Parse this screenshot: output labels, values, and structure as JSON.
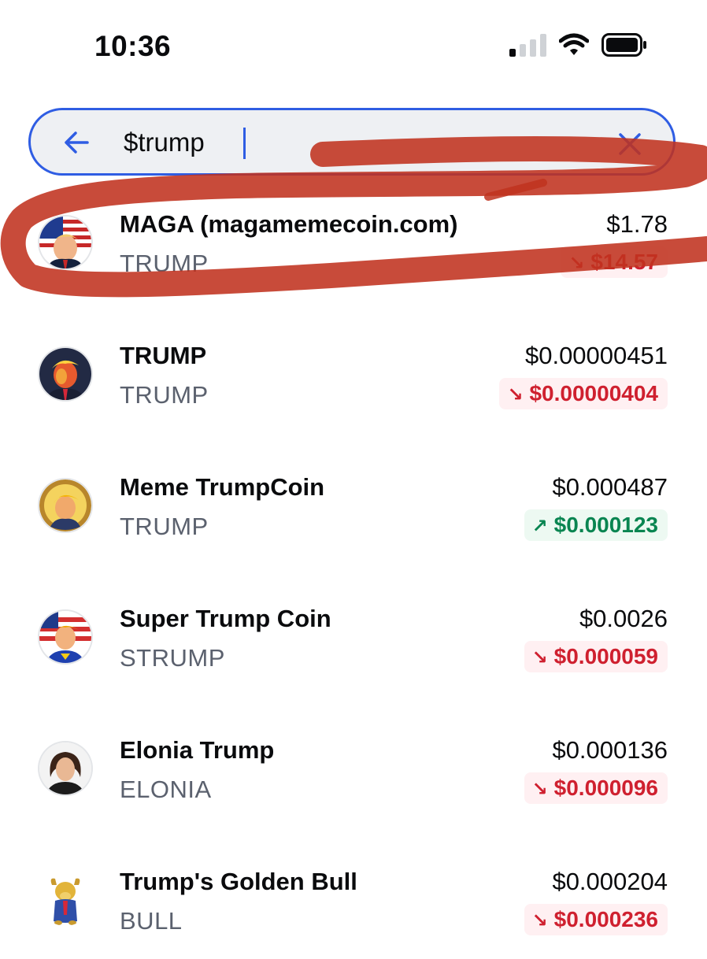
{
  "status_bar": {
    "time": "10:36"
  },
  "search": {
    "value": "$trump"
  },
  "results": [
    {
      "name": "MAGA (magamemecoin.com)",
      "ticker": "TRUMP",
      "price": "$1.78",
      "change": "$14.57",
      "direction": "down",
      "avatar": "trump-flag-avatar"
    },
    {
      "name": "TRUMP",
      "ticker": "TRUMP",
      "price": "$0.00000451",
      "change": "$0.00000404",
      "direction": "down",
      "avatar": "trump-pop-art-avatar"
    },
    {
      "name": "Meme TrumpCoin",
      "ticker": "TRUMP",
      "price": "$0.000487",
      "change": "$0.000123",
      "direction": "up",
      "avatar": "trump-gold-coin-avatar"
    },
    {
      "name": "Super Trump Coin",
      "ticker": "STRUMP",
      "price": "$0.0026",
      "change": "$0.000059",
      "direction": "down",
      "avatar": "trump-superhero-avatar"
    },
    {
      "name": "Elonia Trump",
      "ticker": "ELONIA",
      "price": "$0.000136",
      "change": "$0.000096",
      "direction": "down",
      "avatar": "person-portrait-avatar"
    },
    {
      "name": "Trump's Golden Bull",
      "ticker": "BULL",
      "price": "$0.000204",
      "change": "$0.000236",
      "direction": "down",
      "avatar": "golden-bull-avatar"
    }
  ],
  "colors": {
    "accent": "#2f5de3",
    "negative": "#cf202f",
    "negative_bg": "#fff0f2",
    "positive": "#098551",
    "positive_bg": "#edf9f2",
    "annotation": "#c0321f"
  }
}
